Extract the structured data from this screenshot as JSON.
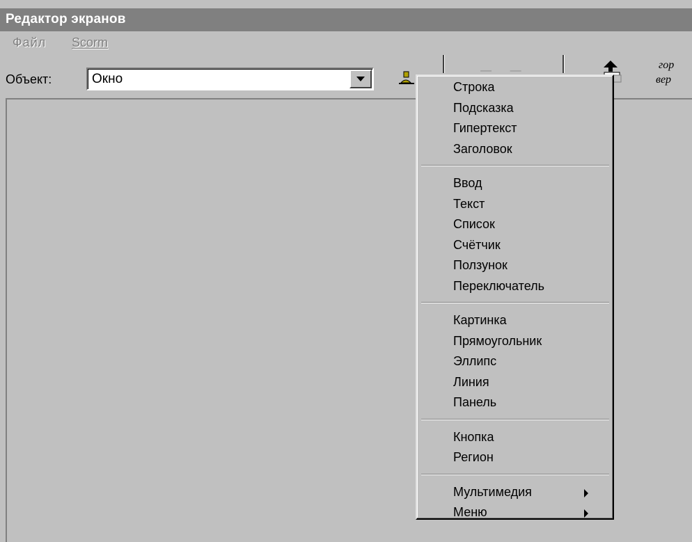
{
  "window": {
    "title": "Редактор экранов"
  },
  "menubar": {
    "items": [
      "Файл",
      "Scorm"
    ]
  },
  "toolbar": {
    "object_label": "Объект:",
    "object_value": "Окно",
    "side_labels": [
      "гор",
      "вер"
    ]
  },
  "context_menu": {
    "groups": [
      [
        "Строка",
        "Подсказка",
        "Гипертекст",
        "Заголовок"
      ],
      [
        "Ввод",
        "Текст",
        "Список",
        "Счётчик",
        "Ползунок",
        "Переключатель"
      ],
      [
        "Картинка",
        "Прямоугольник",
        "Эллипс",
        "Линия",
        "Панель"
      ],
      [
        "Кнопка",
        "Регион"
      ],
      [
        "Мультимедия",
        "Меню"
      ]
    ]
  },
  "colors": {
    "face": "#c0c0c0",
    "title_inactive": "#808080",
    "shadow": "#808080",
    "highlight": "#ffffff"
  },
  "icons": [
    "combo-dropdown-arrow-icon",
    "person-tool-icon",
    "bring-to-front-icon",
    "submenu-arrow-icon"
  ]
}
